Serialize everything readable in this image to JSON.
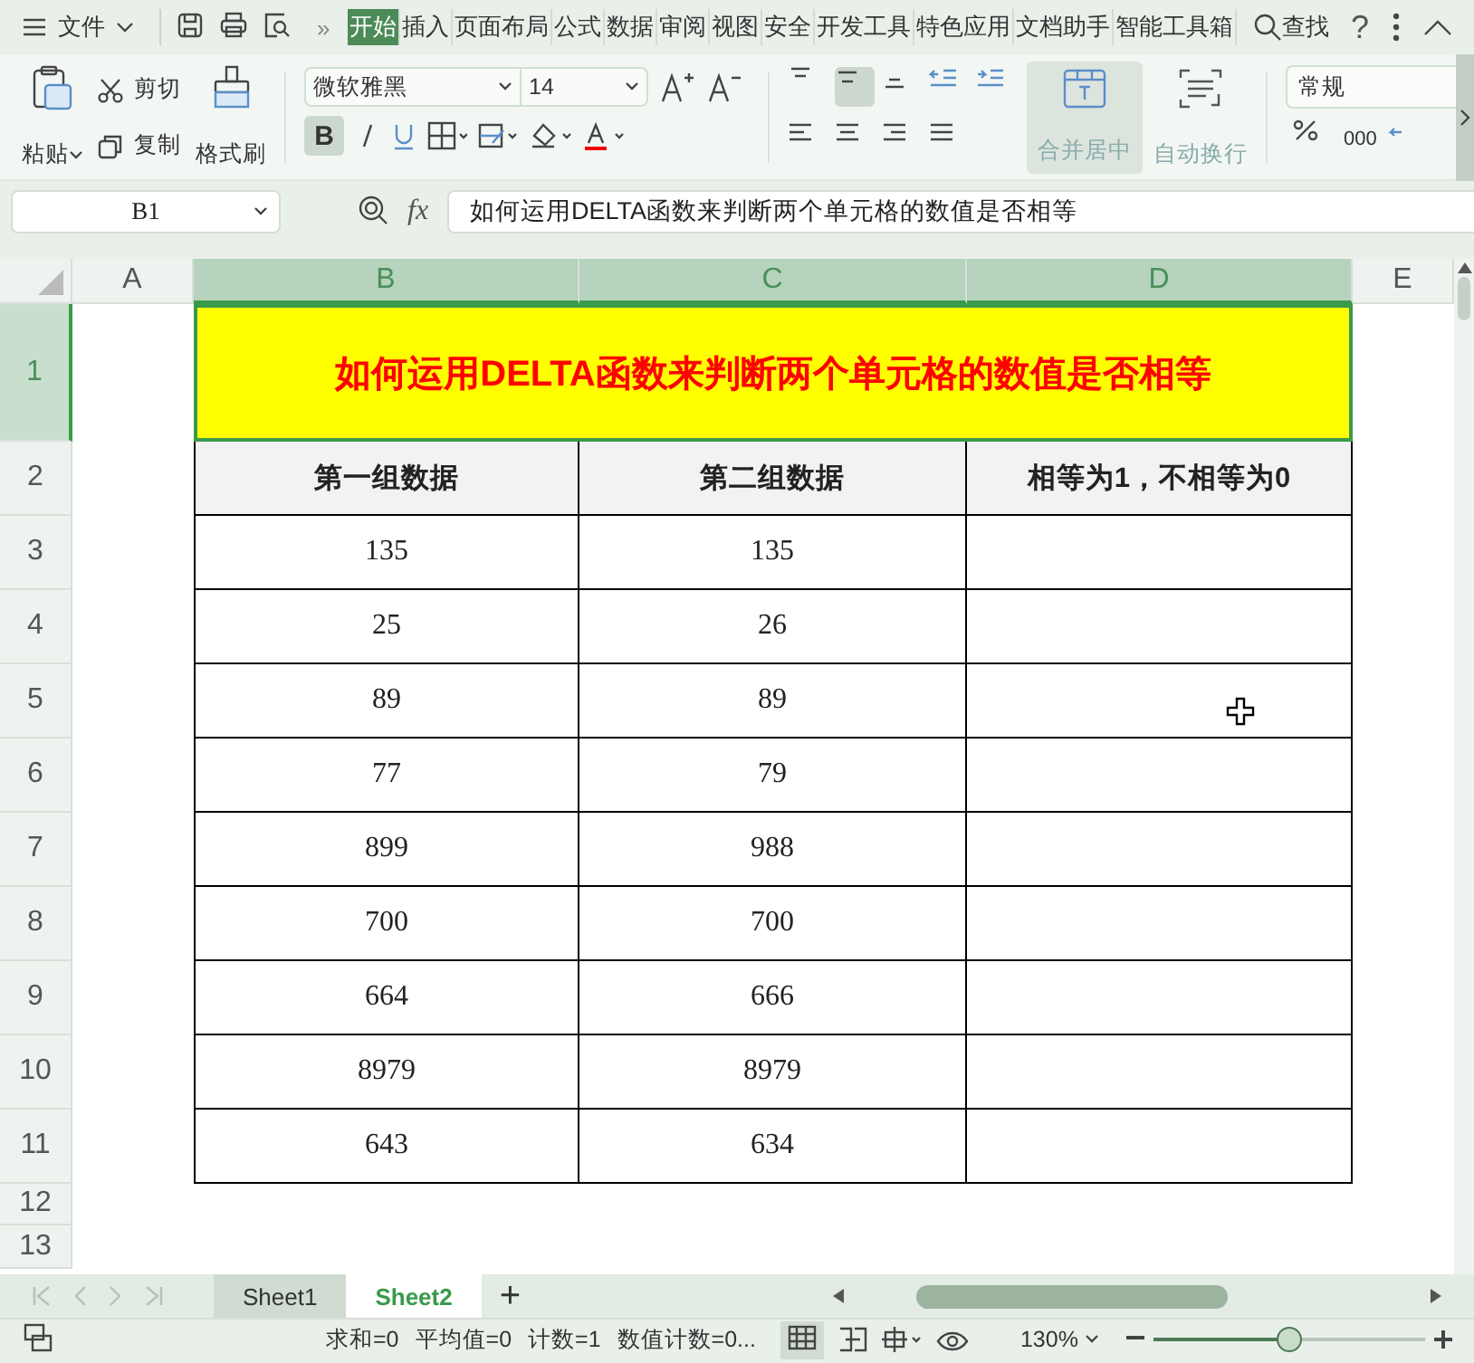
{
  "menu_bar": {
    "file_label": "文件",
    "more_label": "»",
    "tabs": [
      {
        "label": "开始",
        "selected": true
      },
      {
        "label": "插入",
        "selected": false
      },
      {
        "label": "页面布局",
        "selected": false
      },
      {
        "label": "公式",
        "selected": false
      },
      {
        "label": "数据",
        "selected": false
      },
      {
        "label": "审阅",
        "selected": false
      },
      {
        "label": "视图",
        "selected": false
      },
      {
        "label": "安全",
        "selected": false
      },
      {
        "label": "开发工具",
        "selected": false
      },
      {
        "label": "特色应用",
        "selected": false
      },
      {
        "label": "文档助手",
        "selected": false
      },
      {
        "label": "智能工具箱",
        "selected": false
      }
    ],
    "search_label": "查找",
    "help_label": "?"
  },
  "ribbon": {
    "paste": "粘贴",
    "cut": "剪切",
    "copy": "复制",
    "format_painter": "格式刷",
    "font_name": "微软雅黑",
    "font_size": "14",
    "bold_label": "B",
    "bold": true,
    "align_center": true,
    "merge": "合并居中",
    "wrap": "自动换行",
    "number_format": "常规",
    "thousands": "000"
  },
  "formula_bar": {
    "cell_ref": "B1",
    "fx": "fx",
    "value": "如何运用DELTA函数来判断两个单元格的数值是否相等"
  },
  "columns": [
    {
      "label": "A",
      "selected": false
    },
    {
      "label": "B",
      "selected": true
    },
    {
      "label": "C",
      "selected": true
    },
    {
      "label": "D",
      "selected": true
    },
    {
      "label": "E",
      "selected": false
    }
  ],
  "row_headers": [
    {
      "label": "1",
      "selected": true
    },
    {
      "label": "2",
      "selected": false
    },
    {
      "label": "3",
      "selected": false
    },
    {
      "label": "4",
      "selected": false
    },
    {
      "label": "5",
      "selected": false
    },
    {
      "label": "6",
      "selected": false
    },
    {
      "label": "7",
      "selected": false
    },
    {
      "label": "8",
      "selected": false
    },
    {
      "label": "9",
      "selected": false
    },
    {
      "label": "10",
      "selected": false
    },
    {
      "label": "11",
      "selected": false
    },
    {
      "label": "12",
      "selected": false
    },
    {
      "label": "13",
      "selected": false
    }
  ],
  "sheet": {
    "title": "如何运用DELTA函数来判断两个单元格的数值是否相等",
    "header": [
      "第一组数据",
      "第二组数据",
      "相等为1，不相等为0"
    ],
    "rows": [
      [
        "135",
        "135"
      ],
      [
        "25",
        "26"
      ],
      [
        "89",
        "89"
      ],
      [
        "77",
        "79"
      ],
      [
        "899",
        "988"
      ],
      [
        "700",
        "700"
      ],
      [
        "664",
        "666"
      ],
      [
        "8979",
        "8979"
      ],
      [
        "643",
        "634"
      ]
    ]
  },
  "sheet_tabs": {
    "tabs": [
      {
        "label": "Sheet1",
        "selected": false
      },
      {
        "label": "Sheet2",
        "selected": true
      }
    ],
    "add_label": "+"
  },
  "status_bar": {
    "stats": [
      "求和=0",
      "平均值=0",
      "计数=1",
      "数值计数=0..."
    ],
    "zoom": "130%",
    "zoom_slider": {
      "level": 0.5
    }
  }
}
